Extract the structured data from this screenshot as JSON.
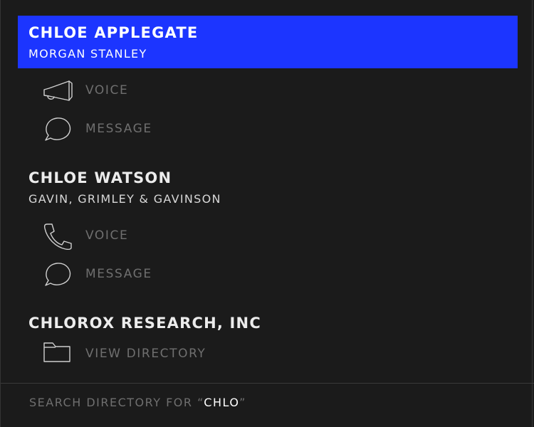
{
  "contacts": [
    {
      "name": "CHLOE APPLEGATE",
      "company": "MORGAN STANLEY",
      "actions": [
        {
          "label": "VOICE",
          "icon": "megaphone-icon"
        },
        {
          "label": "MESSAGE",
          "icon": "speech-bubble-icon"
        }
      ]
    },
    {
      "name": "CHLOE WATSON",
      "company": "GAVIN, GRIMLEY & GAVINSON",
      "actions": [
        {
          "label": "VOICE",
          "icon": "phone-icon"
        },
        {
          "label": "MESSAGE",
          "icon": "speech-bubble-icon"
        }
      ]
    },
    {
      "name": "CHLOROX RESEARCH, INC",
      "actions": [
        {
          "label": "VIEW DIRECTORY",
          "icon": "folder-icon"
        }
      ]
    }
  ],
  "footer": {
    "prefix": "SEARCH DIRECTORY FOR ",
    "open_quote": "“",
    "query": "CHLO",
    "close_quote": "”"
  },
  "colors": {
    "background": "#1b1b1b",
    "highlight": "#1c35ff",
    "primary_text": "#ececec",
    "muted_text": "#6f6f6f"
  }
}
